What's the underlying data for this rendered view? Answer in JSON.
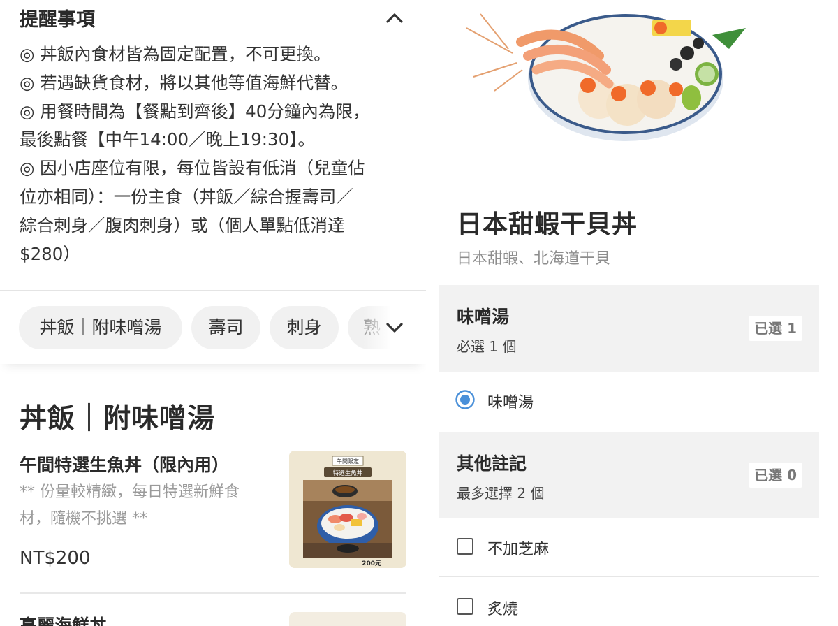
{
  "notice": {
    "title": "提醒事項",
    "lines": [
      "◎ 丼飯內食材皆為固定配置，不可更換。",
      "◎ 若遇缺貨食材，將以其他等值海鮮代替。",
      "◎ 用餐時間為【餐點到齊後】40分鐘內為限，",
      "最後點餐【中午14:00／晚上19:30】。",
      "◎ 因小店座位有限，每位皆設有低消（兒童佔",
      "位亦相同）：一份主食（丼飯／綜合握壽司／",
      "綜合刺身／腹肉刺身）或（個人單點低消達",
      "$280）"
    ]
  },
  "tabs": [
    "丼飯｜附味噌湯",
    "壽司",
    "刺身",
    "熟"
  ],
  "section": {
    "title": "丼飯｜附味噌湯"
  },
  "items": [
    {
      "name": "午間特選生魚丼（限內用）",
      "desc_line1": "** 份量較精緻，每日特選新鮮食",
      "desc_line2": "材，隨機不挑選 **",
      "price": "NT$200",
      "poster": {
        "top": "午間限定",
        "title": "特選生魚丼",
        "price": "200元"
      }
    },
    {
      "name": "高麗海鮮丼"
    }
  ],
  "dish": {
    "title": "日本甜蝦干貝丼",
    "subtitle": "日本甜蝦、北海道干貝"
  },
  "groups": [
    {
      "title": "味噌湯",
      "note": "必選 1 個",
      "badge": "已選 1",
      "options": [
        {
          "label": "味噌湯",
          "type": "radio",
          "selected": true
        }
      ]
    },
    {
      "title": "其他註記",
      "note": "最多選擇 2 個",
      "badge": "已選 0",
      "options": [
        {
          "label": "不加芝麻",
          "type": "checkbox",
          "selected": false
        },
        {
          "label": "炙燒",
          "type": "checkbox",
          "selected": false
        }
      ]
    }
  ],
  "colors": {
    "accent": "#4a90d9",
    "chip_bg": "#f1f1f1",
    "group_bg": "#f2f2f2"
  },
  "icons": {
    "collapse": "chevron-up-icon",
    "expand": "chevron-down-icon"
  }
}
